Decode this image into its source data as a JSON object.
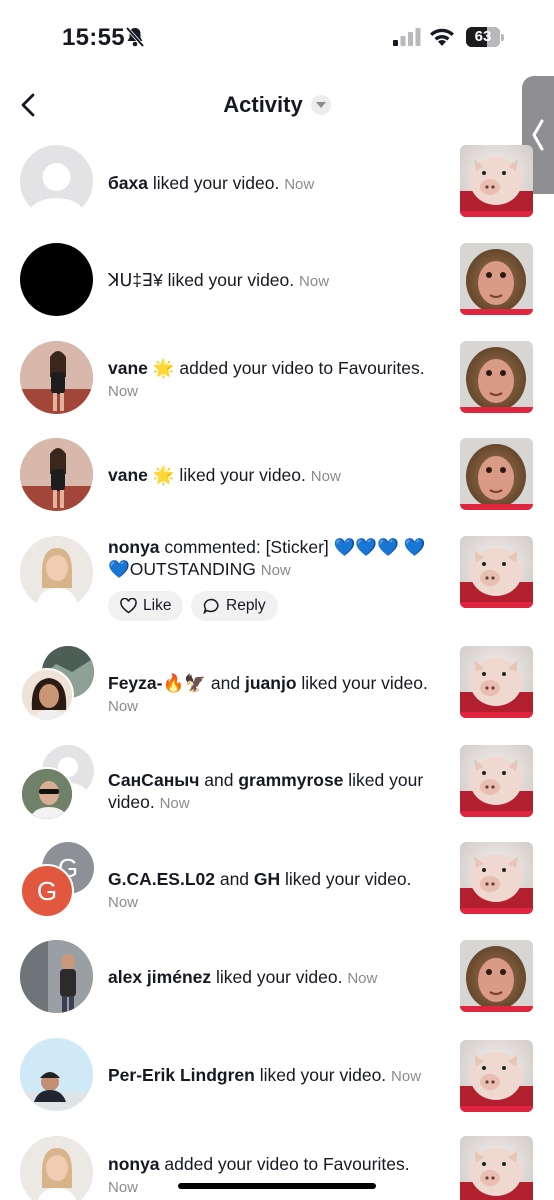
{
  "status_bar": {
    "time": "15:55",
    "battery": "63",
    "battery_level": 0.63
  },
  "header": {
    "title": "Activity",
    "back_icon": "chevron-left-icon",
    "dropdown_icon": "caret-down-icon",
    "side_tab_icon": "chevron-left-icon"
  },
  "actions": {
    "like_label": "Like",
    "reply_label": "Reply"
  },
  "notifications": [
    {
      "user1": "баха",
      "joiner": "",
      "user2": "",
      "action": " liked your video.",
      "time": "Now",
      "thumb": "pig"
    },
    {
      "user1": "",
      "action": "ꓘꓴ‡ꓱ¥ liked your video.",
      "time": "Now",
      "thumb": "monkey"
    },
    {
      "user1": "vane",
      "emoji": "🌟",
      "action": " added your video to Favourites.",
      "time": "Now",
      "thumb": "monkey"
    },
    {
      "user1": "vane",
      "emoji": "🌟",
      "action": " liked your video.",
      "time": "Now",
      "thumb": "monkey"
    },
    {
      "user1": "nonya",
      "action": " commented: [Sticker] 💙💙💙 💙💙OUTSTANDING",
      "time": "Now",
      "thumb": "pig"
    },
    {
      "user1": "Feyza-",
      "emoji": "🔥🦅",
      "joiner": " and ",
      "user2": "juanjo",
      "action": " liked your video.",
      "time": "Now",
      "thumb": "pig"
    },
    {
      "user1": "СанСаныч",
      "joiner": " and ",
      "user2": "grammyrose",
      "action": " liked your video.",
      "time": "Now",
      "thumb": "pig"
    },
    {
      "user1": "G.CA.ES.L02",
      "joiner": " and ",
      "user2": "GH",
      "action": " liked your video.",
      "time": "Now",
      "thumb": "pig",
      "avatar_letter_front": "G",
      "avatar_letter_back": "G"
    },
    {
      "user1": "alex jiménez",
      "action": " liked your video.",
      "time": "Now",
      "thumb": "monkey"
    },
    {
      "user1": "Per-Erik Lindgren",
      "action": " liked your video.",
      "time": "Now",
      "thumb": "pig"
    },
    {
      "user1": "nonya",
      "action": " added your video to Favourites.",
      "time": "Now",
      "thumb": "pig"
    }
  ],
  "colors": {
    "accent_red": "#e0263f",
    "timestamp_gray": "#8a8b91",
    "avatar_orange": "#e2583e"
  }
}
